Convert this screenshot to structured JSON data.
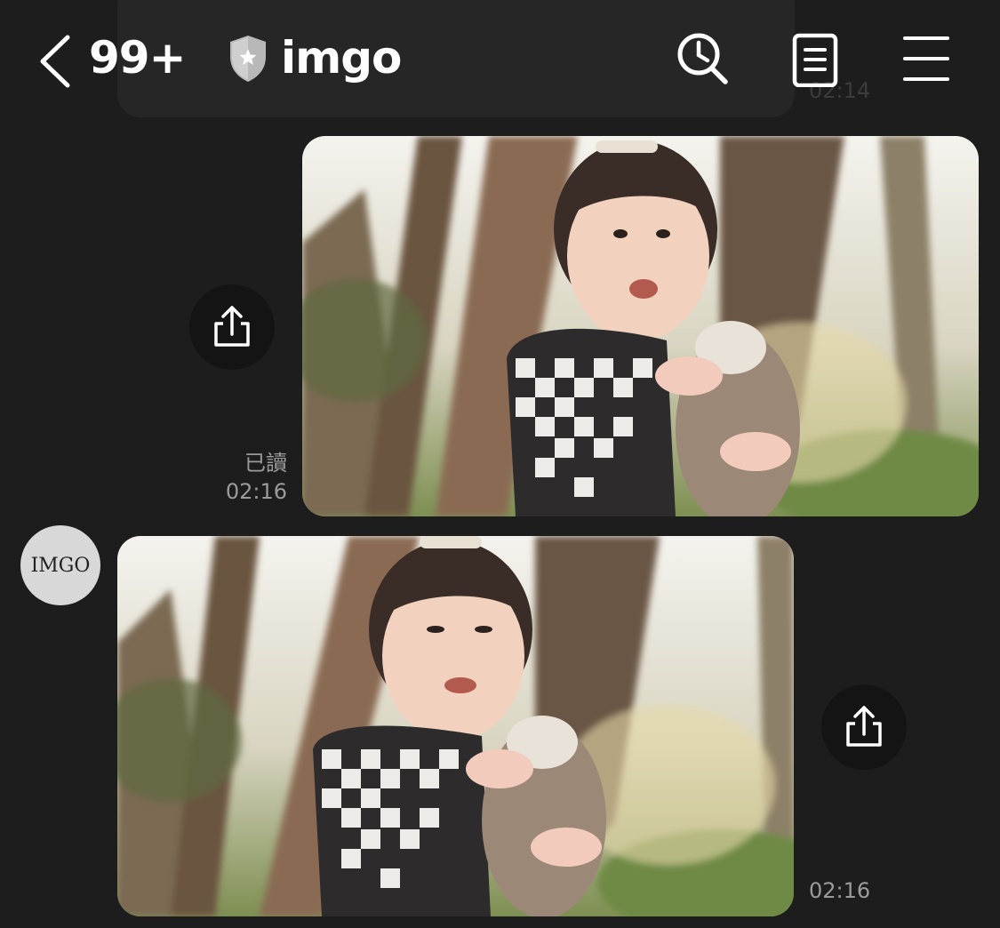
{
  "header": {
    "unread_count": "99+",
    "chat_name": "imgo",
    "icons": [
      "back-chevron-icon",
      "shield-star-icon",
      "search-clock-icon",
      "notes-icon",
      "menu-icon"
    ]
  },
  "previous_message": {
    "time": "02:14"
  },
  "messages": [
    {
      "direction": "sent",
      "type": "image",
      "read_status": "已讀",
      "time": "02:16"
    },
    {
      "direction": "received",
      "type": "image",
      "sender_avatar": "IMGO",
      "time": "02:16"
    }
  ],
  "colors": {
    "background": "#1d1d1d",
    "text": "#ffffff",
    "meta_text": "#9b9b9b",
    "share_button": "#141414"
  }
}
